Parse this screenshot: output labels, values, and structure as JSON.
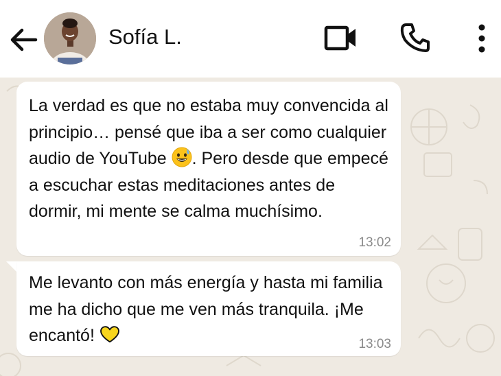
{
  "header": {
    "contact_name": "Sofía L.",
    "icons": {
      "back": "arrow-left-icon",
      "video": "video-camera-icon",
      "call": "phone-icon",
      "menu": "more-vertical-icon"
    }
  },
  "messages": [
    {
      "text_part1": "La verdad es que no estaba muy convencida al principio… pensé que iba a ser como cualquier audio de YouTube ",
      "emoji": "grinning-face-with-sweat-emoji",
      "text_part2": ". Pero desde que empecé a escuchar estas meditaciones antes de dormir, mi mente se calma muchísimo.",
      "time": "13:02"
    },
    {
      "text_part1": "Me levanto con más energía y hasta mi familia me ha dicho que me ven más tranquila. ¡Me encantó! ",
      "emoji": "yellow-heart-emoji",
      "time": "13:03"
    }
  ],
  "colors": {
    "header_bg": "#ffffff",
    "chat_bg": "#efeae2",
    "bubble_bg": "#ffffff",
    "text": "#111111",
    "timestamp": "#8a8a8a",
    "heart": "#f7d51d"
  }
}
